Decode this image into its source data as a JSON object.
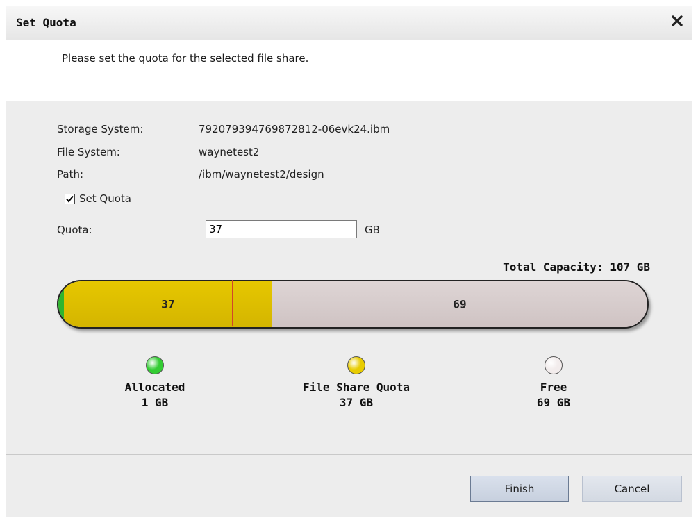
{
  "dialog": {
    "title": "Set Quota",
    "intro": "Please set the quota for the selected file share."
  },
  "details": {
    "storage_system_label": "Storage System:",
    "storage_system_value": "792079394769872812-06evk24.ibm",
    "file_system_label": "File System:",
    "file_system_value": "waynetest2",
    "path_label": "Path:",
    "path_value": "/ibm/waynetest2/design"
  },
  "quota": {
    "checkbox_label": "Set Quota",
    "checked": true,
    "field_label": "Quota:",
    "field_value": "37",
    "unit": "GB"
  },
  "capacity": {
    "total_label": "Total Capacity: 107 GB",
    "total_gb": 107,
    "allocated_gb": 1,
    "quota_gb": 37,
    "free_gb": 69,
    "quota_text": "37",
    "free_text": "69"
  },
  "legend": [
    {
      "name": "Allocated",
      "value": "1 GB",
      "color": "#33cc33"
    },
    {
      "name": "File Share Quota",
      "value": "37 GB",
      "color": "#e8cc00"
    },
    {
      "name": "Free",
      "value": "69 GB",
      "color": "#f2ecec"
    }
  ],
  "buttons": {
    "finish": "Finish",
    "cancel": "Cancel"
  },
  "icons": {
    "close": "close-icon",
    "checkmark": "checkmark-icon"
  },
  "colors": {
    "allocated": "#2fb52f",
    "quota": "#e0c200",
    "free": "#d7cccc",
    "marker": "#d2452a"
  }
}
